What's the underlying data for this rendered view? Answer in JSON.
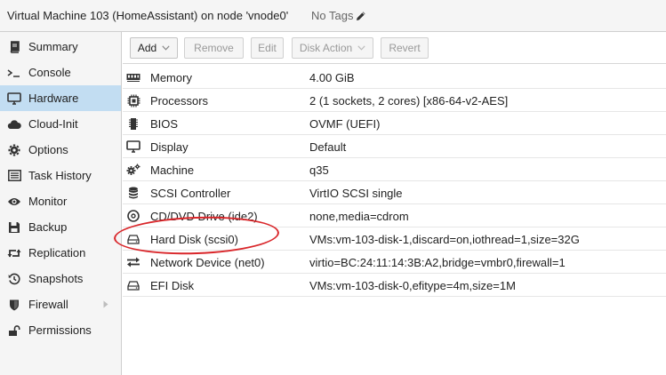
{
  "header": {
    "title": "Virtual Machine 103 (HomeAssistant) on node 'vnode0'",
    "tags": "No Tags",
    "tags_icon": "pencil-icon"
  },
  "sidebar": {
    "items": [
      {
        "label": "Summary",
        "icon": "book-icon"
      },
      {
        "label": "Console",
        "icon": "terminal-icon"
      },
      {
        "label": "Hardware",
        "icon": "desktop-icon",
        "active": true
      },
      {
        "label": "Cloud-Init",
        "icon": "cloud-icon"
      },
      {
        "label": "Options",
        "icon": "gear-icon"
      },
      {
        "label": "Task History",
        "icon": "list-icon"
      },
      {
        "label": "Monitor",
        "icon": "eye-icon"
      },
      {
        "label": "Backup",
        "icon": "floppy-icon"
      },
      {
        "label": "Replication",
        "icon": "retweet-icon"
      },
      {
        "label": "Snapshots",
        "icon": "history-icon"
      },
      {
        "label": "Firewall",
        "icon": "shield-icon"
      },
      {
        "label": "Permissions",
        "icon": "unlock-icon"
      }
    ]
  },
  "toolbar": {
    "add": "Add",
    "remove": "Remove",
    "edit": "Edit",
    "disk_action": "Disk Action",
    "revert": "Revert"
  },
  "hardware": [
    {
      "name": "Memory",
      "value": "4.00 GiB",
      "icon": "memory-icon"
    },
    {
      "name": "Processors",
      "value": "2 (1 sockets, 2 cores) [x86-64-v2-AES]",
      "icon": "cpu-icon"
    },
    {
      "name": "BIOS",
      "value": "OVMF (UEFI)",
      "icon": "microchip-icon"
    },
    {
      "name": "Display",
      "value": "Default",
      "icon": "desktop-icon"
    },
    {
      "name": "Machine",
      "value": "q35",
      "icon": "cogs-icon"
    },
    {
      "name": "SCSI Controller",
      "value": "VirtIO SCSI single",
      "icon": "database-icon"
    },
    {
      "name": "CD/DVD Drive (ide2)",
      "value": "none,media=cdrom",
      "icon": "cdrom-icon"
    },
    {
      "name": "Hard Disk (scsi0)",
      "value": "VMs:vm-103-disk-1,discard=on,iothread=1,size=32G",
      "icon": "hdd-icon"
    },
    {
      "name": "Network Device (net0)",
      "value": "virtio=BC:24:11:14:3B:A2,bridge=vmbr0,firewall=1",
      "icon": "exchange-icon"
    },
    {
      "name": "EFI Disk",
      "value": "VMs:vm-103-disk-0,efitype=4m,size=1M",
      "icon": "hdd-icon"
    }
  ],
  "colors": {
    "active_nav": "#c2ddf2",
    "highlight_ellipse": "#d9262a"
  }
}
